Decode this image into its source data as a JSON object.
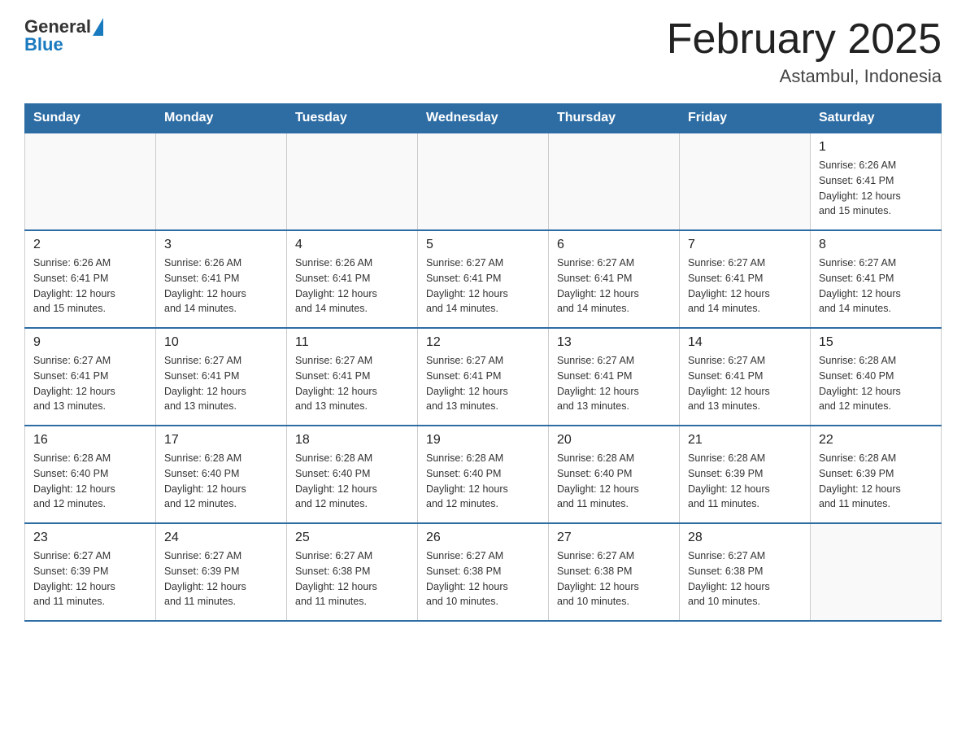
{
  "header": {
    "logo_general": "General",
    "logo_blue": "Blue",
    "month_title": "February 2025",
    "location": "Astambul, Indonesia"
  },
  "days_of_week": [
    "Sunday",
    "Monday",
    "Tuesday",
    "Wednesday",
    "Thursday",
    "Friday",
    "Saturday"
  ],
  "weeks": [
    [
      {
        "day": "",
        "info": ""
      },
      {
        "day": "",
        "info": ""
      },
      {
        "day": "",
        "info": ""
      },
      {
        "day": "",
        "info": ""
      },
      {
        "day": "",
        "info": ""
      },
      {
        "day": "",
        "info": ""
      },
      {
        "day": "1",
        "info": "Sunrise: 6:26 AM\nSunset: 6:41 PM\nDaylight: 12 hours\nand 15 minutes."
      }
    ],
    [
      {
        "day": "2",
        "info": "Sunrise: 6:26 AM\nSunset: 6:41 PM\nDaylight: 12 hours\nand 15 minutes."
      },
      {
        "day": "3",
        "info": "Sunrise: 6:26 AM\nSunset: 6:41 PM\nDaylight: 12 hours\nand 14 minutes."
      },
      {
        "day": "4",
        "info": "Sunrise: 6:26 AM\nSunset: 6:41 PM\nDaylight: 12 hours\nand 14 minutes."
      },
      {
        "day": "5",
        "info": "Sunrise: 6:27 AM\nSunset: 6:41 PM\nDaylight: 12 hours\nand 14 minutes."
      },
      {
        "day": "6",
        "info": "Sunrise: 6:27 AM\nSunset: 6:41 PM\nDaylight: 12 hours\nand 14 minutes."
      },
      {
        "day": "7",
        "info": "Sunrise: 6:27 AM\nSunset: 6:41 PM\nDaylight: 12 hours\nand 14 minutes."
      },
      {
        "day": "8",
        "info": "Sunrise: 6:27 AM\nSunset: 6:41 PM\nDaylight: 12 hours\nand 14 minutes."
      }
    ],
    [
      {
        "day": "9",
        "info": "Sunrise: 6:27 AM\nSunset: 6:41 PM\nDaylight: 12 hours\nand 13 minutes."
      },
      {
        "day": "10",
        "info": "Sunrise: 6:27 AM\nSunset: 6:41 PM\nDaylight: 12 hours\nand 13 minutes."
      },
      {
        "day": "11",
        "info": "Sunrise: 6:27 AM\nSunset: 6:41 PM\nDaylight: 12 hours\nand 13 minutes."
      },
      {
        "day": "12",
        "info": "Sunrise: 6:27 AM\nSunset: 6:41 PM\nDaylight: 12 hours\nand 13 minutes."
      },
      {
        "day": "13",
        "info": "Sunrise: 6:27 AM\nSunset: 6:41 PM\nDaylight: 12 hours\nand 13 minutes."
      },
      {
        "day": "14",
        "info": "Sunrise: 6:27 AM\nSunset: 6:41 PM\nDaylight: 12 hours\nand 13 minutes."
      },
      {
        "day": "15",
        "info": "Sunrise: 6:28 AM\nSunset: 6:40 PM\nDaylight: 12 hours\nand 12 minutes."
      }
    ],
    [
      {
        "day": "16",
        "info": "Sunrise: 6:28 AM\nSunset: 6:40 PM\nDaylight: 12 hours\nand 12 minutes."
      },
      {
        "day": "17",
        "info": "Sunrise: 6:28 AM\nSunset: 6:40 PM\nDaylight: 12 hours\nand 12 minutes."
      },
      {
        "day": "18",
        "info": "Sunrise: 6:28 AM\nSunset: 6:40 PM\nDaylight: 12 hours\nand 12 minutes."
      },
      {
        "day": "19",
        "info": "Sunrise: 6:28 AM\nSunset: 6:40 PM\nDaylight: 12 hours\nand 12 minutes."
      },
      {
        "day": "20",
        "info": "Sunrise: 6:28 AM\nSunset: 6:40 PM\nDaylight: 12 hours\nand 11 minutes."
      },
      {
        "day": "21",
        "info": "Sunrise: 6:28 AM\nSunset: 6:39 PM\nDaylight: 12 hours\nand 11 minutes."
      },
      {
        "day": "22",
        "info": "Sunrise: 6:28 AM\nSunset: 6:39 PM\nDaylight: 12 hours\nand 11 minutes."
      }
    ],
    [
      {
        "day": "23",
        "info": "Sunrise: 6:27 AM\nSunset: 6:39 PM\nDaylight: 12 hours\nand 11 minutes."
      },
      {
        "day": "24",
        "info": "Sunrise: 6:27 AM\nSunset: 6:39 PM\nDaylight: 12 hours\nand 11 minutes."
      },
      {
        "day": "25",
        "info": "Sunrise: 6:27 AM\nSunset: 6:38 PM\nDaylight: 12 hours\nand 11 minutes."
      },
      {
        "day": "26",
        "info": "Sunrise: 6:27 AM\nSunset: 6:38 PM\nDaylight: 12 hours\nand 10 minutes."
      },
      {
        "day": "27",
        "info": "Sunrise: 6:27 AM\nSunset: 6:38 PM\nDaylight: 12 hours\nand 10 minutes."
      },
      {
        "day": "28",
        "info": "Sunrise: 6:27 AM\nSunset: 6:38 PM\nDaylight: 12 hours\nand 10 minutes."
      },
      {
        "day": "",
        "info": ""
      }
    ]
  ]
}
